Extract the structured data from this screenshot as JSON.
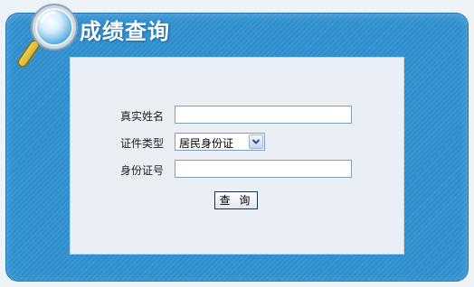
{
  "header": {
    "title": "成绩查询"
  },
  "form": {
    "name_label": "真实姓名",
    "name_value": "",
    "id_type_label": "证件类型",
    "id_type_selected": "居民身份证",
    "id_number_label": "身份证号",
    "id_number_value": "",
    "submit_label": "查 询"
  },
  "colors": {
    "frame_blue": "#2f8fce",
    "panel_bg": "#e9eff4",
    "input_border": "#7f9db9"
  }
}
